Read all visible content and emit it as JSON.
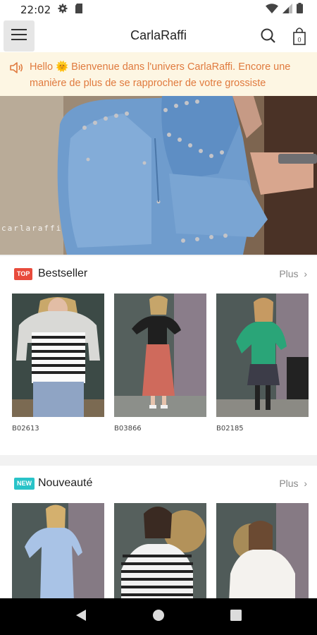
{
  "status_bar": {
    "time": "22:02",
    "icons": [
      "gear-icon",
      "sd-card-icon",
      "wifi-icon",
      "signal-icon",
      "battery-icon"
    ]
  },
  "app_bar": {
    "title": "CarlaRaffi",
    "icons": [
      "menu-icon",
      "search-icon",
      "shopping-bag-icon"
    ],
    "bag_count": "0"
  },
  "announcement": {
    "icon": "speaker-icon",
    "text": "Hello 🌞 Bienvenue dans l'univers CarlaRaffi. Encore une manière de plus de se rapprocher de votre grossiste"
  },
  "banner": {
    "watermark": "carlaraffi"
  },
  "sections": {
    "bestseller": {
      "badge": "TOP",
      "title": "Bestseller",
      "more": "Plus",
      "products": [
        {
          "code": "B02613"
        },
        {
          "code": "B03866"
        },
        {
          "code": "B02185"
        }
      ]
    },
    "new": {
      "badge": "NEW",
      "title": "Nouveauté",
      "more": "Plus"
    }
  },
  "colors": {
    "accent_orange": "#e07a3e",
    "top_badge": "#e84b3c",
    "new_badge": "#29c3c8",
    "announcement_bg": "#fdf6e3"
  },
  "nav_bar": {
    "icons": [
      "back-icon",
      "home-icon",
      "recents-icon"
    ]
  }
}
